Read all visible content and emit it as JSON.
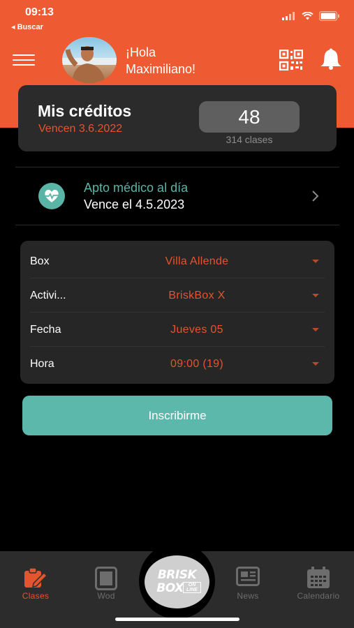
{
  "status_bar": {
    "time": "09:13",
    "back_label": "◂ Buscar"
  },
  "header": {
    "greeting_line1": "¡Hola",
    "greeting_line2": "Maximiliano!"
  },
  "credits": {
    "title": "Mis créditos",
    "expiry": "Vencen 3.6.2022",
    "count": "48",
    "classes": "314 clases"
  },
  "medical": {
    "title": "Apto médico al día",
    "expiry": "Vence el 4.5.2023"
  },
  "booking": {
    "rows": [
      {
        "label": "Box",
        "value": "Villa Allende"
      },
      {
        "label": "Activi...",
        "value": "BriskBox X"
      },
      {
        "label": "Fecha",
        "value": "Jueves 05"
      },
      {
        "label": "Hora",
        "value": "09:00 (19)"
      }
    ]
  },
  "enroll_label": "Inscribirme",
  "tabs": [
    {
      "label": "Clases",
      "icon": "clipboard-edit-icon",
      "active": true
    },
    {
      "label": "Wod",
      "icon": "tablet-icon",
      "active": false
    },
    {
      "label": "News",
      "icon": "newspaper-icon",
      "active": false
    },
    {
      "label": "Calendario",
      "icon": "calendar-icon",
      "active": false
    }
  ],
  "logo": {
    "line1": "BRISK",
    "line2": "BOX",
    "badge_top": "ON",
    "badge_bottom": "LINE"
  },
  "colors": {
    "brand_orange": "#ee5a32",
    "accent_orange_text": "#e2552f",
    "accent_teal": "#5db8ac",
    "card_bg": "#2b2b2b",
    "background": "#000000"
  }
}
